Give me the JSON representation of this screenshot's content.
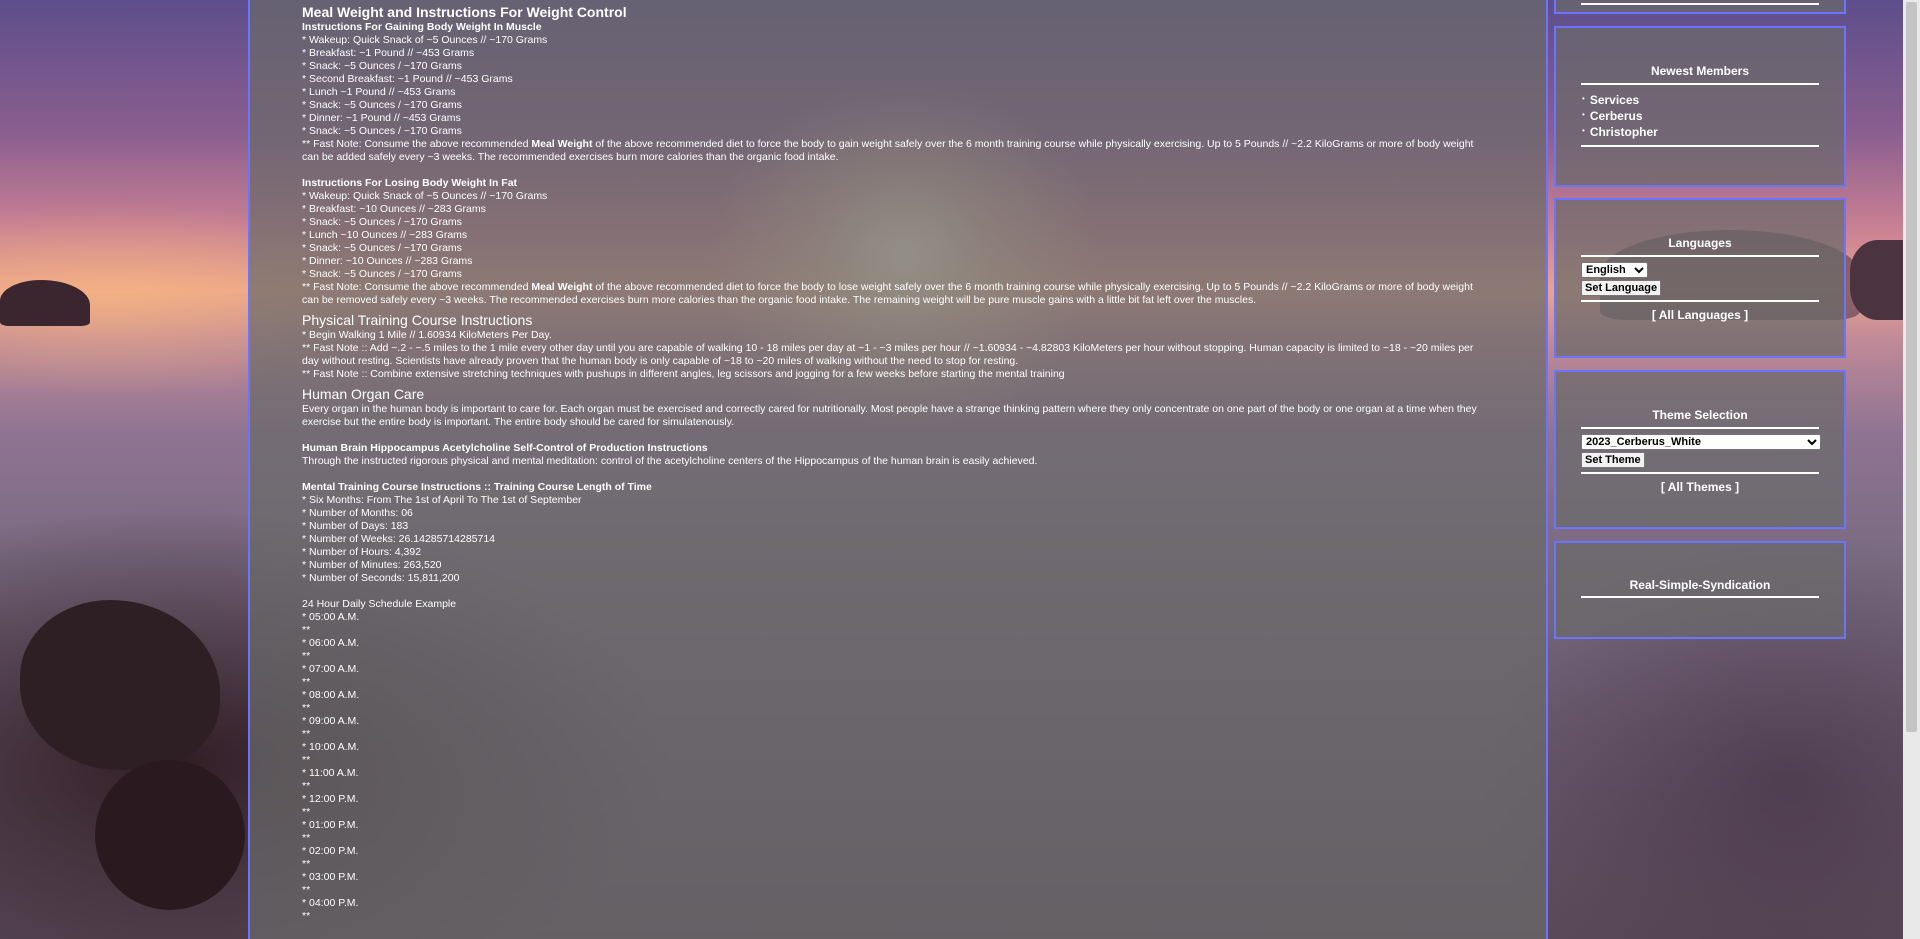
{
  "main": {
    "section1": {
      "title": "Meal Weight and Instructions For Weight Control",
      "gain_heading": "Instructions For Gaining Body Weight In Muscle",
      "gain_items": [
        "* Wakeup: Quick Snack of ~5 Ounces // ~170 Grams",
        "* Breakfast: ~1 Pound // ~453 Grams",
        "* Snack: ~5 Ounces / ~170 Grams",
        "* Second Breakfast: ~1 Pound // ~453 Grams",
        "* Lunch ~1 Pound // ~453 Grams",
        "* Snack: ~5 Ounces / ~170 Grams",
        "* Dinner: ~1 Pound // ~453 Grams",
        "* Snack: ~5 Ounces / ~170 Grams"
      ],
      "gain_note_pre": "** Fast Note: Consume the above recommended ",
      "gain_note_bold": "Meal Weight",
      "gain_note_post": " of the above recommended diet to force the body to gain weight safely over the 6 month training course while physically exercising. Up to 5 Pounds // ~2.2 KiloGrams or more of body weight can be added safely every ~3 weeks. The recommended exercises burn more calories than the organic food intake.",
      "lose_heading": "Instructions For Losing Body Weight In Fat",
      "lose_items": [
        "* Wakeup: Quick Snack of ~5 Ounces // ~170 Grams",
        "* Breakfast: ~10 Ounces // ~283 Grams",
        "* Snack: ~5 Ounces / ~170 Grams",
        "* Lunch ~10 Ounces // ~283 Grams",
        "* Snack: ~5 Ounces / ~170 Grams",
        "* Dinner: ~10 Ounces // ~283 Grams",
        "* Snack: ~5 Ounces / ~170 Grams"
      ],
      "lose_note_pre": "** Fast Note: Consume the above recommended ",
      "lose_note_bold": "Meal Weight",
      "lose_note_post": " of the above recommended diet to force the body to lose weight safely over the 6 month training course while physically exercising. Up to 5 Pounds // ~2.2 KiloGrams or more of body weight can be removed safely every ~3 weeks. The recommended exercises burn more calories than the organic food intake. The remaining weight will be pure muscle gains with a little bit fat left over the muscles."
    },
    "section2": {
      "title": "Physical Training Course Instructions",
      "line1": "* Begin Walking 1 Mile // 1.60934 KiloMeters Per Day.",
      "line2": "** Fast Note :: Add ~.2 - ~.5 miles to the 1 mile every other day until you are capable of walking 10 - 18 miles per day at ~1 - ~3 miles per hour // ~1.60934 - ~4.82803 KiloMeters per hour without stopping. Human capacity is limited to ~18 - ~20 miles per day without resting. Scientists have already proven that the human body is only capable of ~18 to ~20 miles of walking without the need to stop for resting.",
      "line3": "** Fast Note :: Combine extensive stretching techniques with pushups in different angles, leg scissors and jogging for a few weeks before starting the mental training"
    },
    "section3": {
      "title": "Human Organ Care",
      "text": "Every organ in the human body is important to care for. Each organ must be exercised and correctly cared for nutritionally. Most people have a strange thinking pattern where they only concentrate on one part of the body or one organ at a time when they exercise but the entire body is important. The entire body should be cared for simulatenously."
    },
    "section4": {
      "title": "Human Brain Hippocampus Acetylcholine Self-Control of Production Instructions",
      "text": "Through the instructed rigorous physical and mental meditation: control of the acetylcholine centers of the Hippocampus of the human brain is easily achieved."
    },
    "section5": {
      "title": "Mental Training Course Instructions :: Training Course Length of Time",
      "items": [
        "* Six Months: From The 1st of April To The 1st of September",
        "* Number of Months: 06",
        "* Number of Days: 183",
        "* Number of Weeks: 26.14285714285714",
        "* Number of Hours: 4,392",
        "* Number of Minutes: 263,520",
        "* Number of Seconds: 15,811,200"
      ],
      "schedule_title": "24 Hour Daily Schedule Example",
      "schedule": [
        "* 05:00 A.M.",
        "**",
        "* 06:00 A.M.",
        "**",
        "* 07:00 A.M.",
        "**",
        "* 08:00 A.M.",
        "**",
        "* 09:00 A.M.",
        "**",
        "* 10:00 A.M.",
        "**",
        "* 11:00 A.M.",
        "**",
        "* 12:00 P.M.",
        "**",
        "* 01:00 P.M.",
        "**",
        "* 02:00 P.M.",
        "**",
        "* 03:00 P.M.",
        "**",
        "* 04:00 P.M.",
        "**"
      ]
    }
  },
  "sidebar": {
    "members": {
      "title": "Newest Members",
      "items": [
        "Services",
        "Cerberus",
        "Christopher"
      ]
    },
    "languages": {
      "title": "Languages",
      "selected": "English",
      "button": "Set Language",
      "all_link": "[ All Languages ]"
    },
    "themes": {
      "title": "Theme Selection",
      "selected": "2023_Cerberus_White",
      "button": "Set Theme",
      "all_link": "[ All Themes ]"
    },
    "rss": {
      "title": "Real-Simple-Syndication"
    }
  },
  "colors": {
    "panel_border": "#6b74ff",
    "panel_bg": "rgba(105,105,105,0.72)",
    "text": "#ffffff"
  }
}
